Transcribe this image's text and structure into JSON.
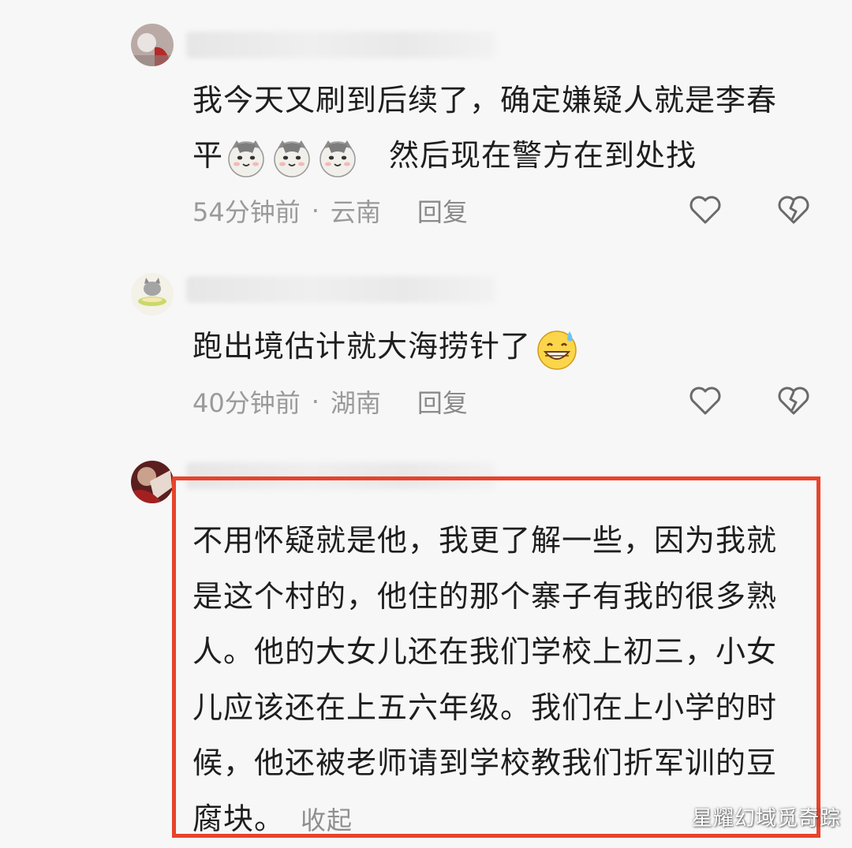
{
  "comments": [
    {
      "text_line1": "我今天又刷到后续了，确定嫌疑人就是李春",
      "text_line2_a": "平",
      "text_line2_b": "然后现在警方在到处找",
      "time": "54分钟前",
      "location": "云南",
      "reply": "回复",
      "emoji": "cat-face-emoji"
    },
    {
      "text": "跑出境估计就大海捞针了",
      "time": "40分钟前",
      "location": "湖南",
      "reply": "回复",
      "emoji": "grinning-sweat-emoji"
    },
    {
      "lines": [
        "不用怀疑就是他，我更了解一些，因为我就",
        "是这个村的，他住的那个寨子有我的很多熟",
        "人。他的大女儿还在我们学校上初三，小女",
        "儿应该还在上五六年级。我们在上小学的时",
        "候，他还被老师请到学校教我们折军训的豆"
      ],
      "last_line": "腐块。",
      "collapse": "收起",
      "highlight_color": "#e8432c"
    }
  ],
  "separator": "·",
  "watermark": "星耀幻域觅奇踪"
}
